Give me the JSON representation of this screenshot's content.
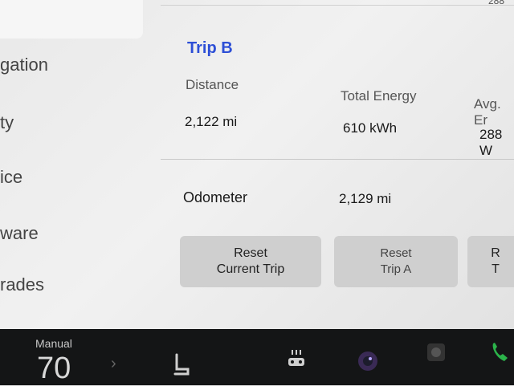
{
  "sidebar": {
    "items": [
      {
        "label": "gation"
      },
      {
        "label": "ty"
      },
      {
        "label": "ice"
      },
      {
        "label": "ware"
      },
      {
        "label": "rades"
      }
    ]
  },
  "main": {
    "top_number": "288",
    "trip_title": "Trip B",
    "stats": {
      "distance_label": "Distance",
      "distance_value": "2,122 mi",
      "energy_label": "Total Energy",
      "energy_value": "610 kWh",
      "avg_label": "Avg. Er",
      "avg_value": "288 W"
    },
    "odometer_label": "Odometer",
    "odometer_value": "2,129 mi",
    "buttons": {
      "reset_current_line1": "Reset",
      "reset_current_line2": "Current Trip",
      "reset_a_line1": "Reset",
      "reset_a_line2": "Trip A",
      "reset_b_line1": "R",
      "reset_b_line2": "T"
    }
  },
  "bottombar": {
    "mode_label": "Manual",
    "temperature": "70",
    "icons": [
      "seat-heater-icon",
      "rear-defrost-icon",
      "camera-icon",
      "dashcam-icon",
      "phone-icon"
    ]
  },
  "colors": {
    "accent": "#2d4fd6",
    "phone": "#2bb34a"
  }
}
